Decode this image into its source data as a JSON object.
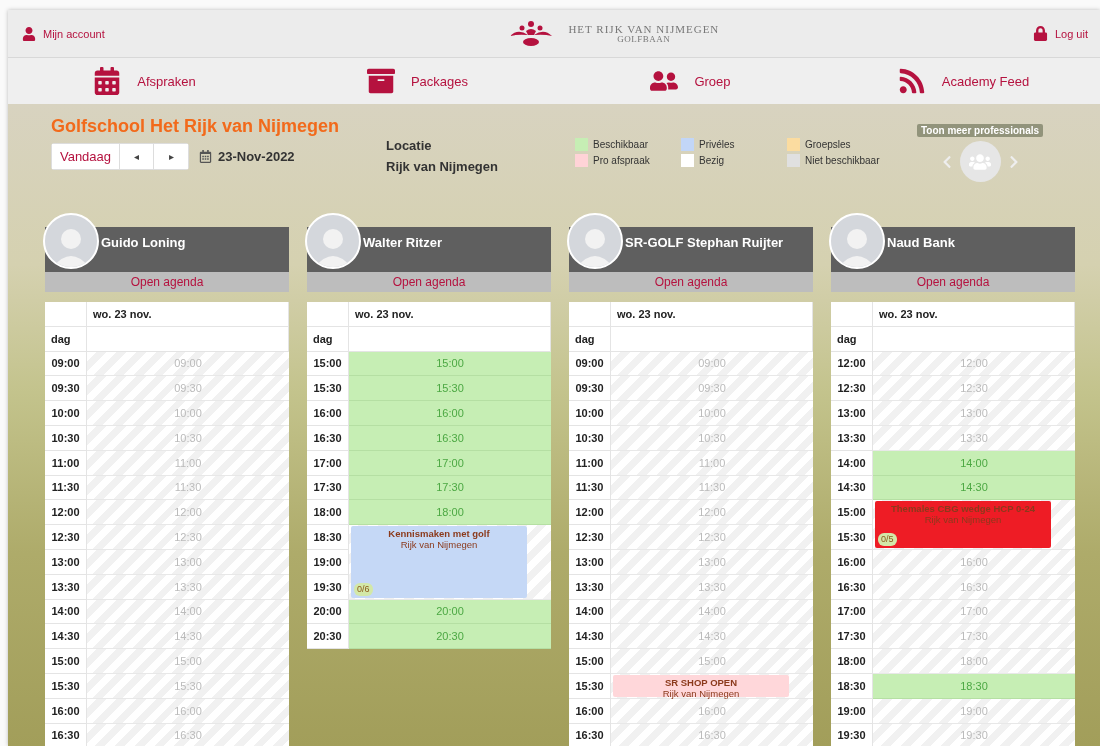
{
  "header": {
    "account": "Mijn account",
    "logo_line_1": "HET RIJK VAN NIJMEGEN",
    "logo_line_2": "GOLFBAAN",
    "logout": "Log uit"
  },
  "nav": [
    {
      "label": "Afspraken"
    },
    {
      "label": "Packages"
    },
    {
      "label": "Groep"
    },
    {
      "label": "Academy Feed"
    }
  ],
  "title": "Golfschool Het Rijk van Nijmegen",
  "controls": {
    "today": "Vandaag",
    "prev": "◂",
    "next": "▸",
    "date": "23-Nov-2022"
  },
  "location": {
    "label": "Locatie",
    "value": "Rijk van Nijmegen"
  },
  "legend": [
    {
      "label": "Beschikbaar",
      "color": "#c6eeb4"
    },
    {
      "label": "Privéles",
      "color": "#c2d6f7"
    },
    {
      "label": "Groepsles",
      "color": "#fbdca0"
    },
    {
      "label": "Pro afspraak",
      "color": "#ffd3d7"
    },
    {
      "label": "Bezig",
      "color": "#ffffff"
    },
    {
      "label": "Niet beschikbaar",
      "color": "#e0e0e0"
    }
  ],
  "more_pros": {
    "label": "Toon meer professionals"
  },
  "agendas": [
    {
      "name": "Guido Loning",
      "open": "Open agenda",
      "day": "wo. 23 nov.",
      "dag": "dag",
      "rows": [
        {
          "time": "09:00",
          "kind": "unavailable",
          "label": "09:00"
        },
        {
          "time": "09:30",
          "kind": "unavailable",
          "label": "09:30"
        },
        {
          "time": "10:00",
          "kind": "unavailable",
          "label": "10:00"
        },
        {
          "time": "10:30",
          "kind": "unavailable",
          "label": "10:30"
        },
        {
          "time": "11:00",
          "kind": "unavailable",
          "label": "11:00"
        },
        {
          "time": "11:30",
          "kind": "unavailable",
          "label": "11:30"
        },
        {
          "time": "12:00",
          "kind": "unavailable",
          "label": "12:00"
        },
        {
          "time": "12:30",
          "kind": "unavailable",
          "label": "12:30"
        },
        {
          "time": "13:00",
          "kind": "unavailable",
          "label": "13:00"
        },
        {
          "time": "13:30",
          "kind": "unavailable",
          "label": "13:30"
        },
        {
          "time": "14:00",
          "kind": "unavailable",
          "label": "14:00"
        },
        {
          "time": "14:30",
          "kind": "unavailable",
          "label": "14:30"
        },
        {
          "time": "15:00",
          "kind": "unavailable",
          "label": "15:00"
        },
        {
          "time": "15:30",
          "kind": "unavailable",
          "label": "15:30"
        },
        {
          "time": "16:00",
          "kind": "unavailable",
          "label": "16:00"
        },
        {
          "time": "16:30",
          "kind": "unavailable",
          "label": "16:30"
        }
      ]
    },
    {
      "name": "Walter Ritzer",
      "open": "Open agenda",
      "day": "wo. 23 nov.",
      "dag": "dag",
      "rows": [
        {
          "time": "15:00",
          "kind": "available",
          "label": "15:00"
        },
        {
          "time": "15:30",
          "kind": "available",
          "label": "15:30"
        },
        {
          "time": "16:00",
          "kind": "available",
          "label": "16:00"
        },
        {
          "time": "16:30",
          "kind": "available",
          "label": "16:30"
        },
        {
          "time": "17:00",
          "kind": "available",
          "label": "17:00"
        },
        {
          "time": "17:30",
          "kind": "available",
          "label": "17:30"
        },
        {
          "time": "18:00",
          "kind": "available",
          "label": "18:00"
        },
        {
          "time": "18:30",
          "kind": "event",
          "event": {
            "title": "Kennismaken met golf",
            "place": "Rijk van Nijmegen",
            "count": "0/6",
            "color": "#c5d8f6"
          }
        },
        {
          "time": "19:00",
          "kind": "continued"
        },
        {
          "time": "19:30",
          "kind": "continued"
        },
        {
          "time": "20:00",
          "kind": "available",
          "label": "20:00"
        },
        {
          "time": "20:30",
          "kind": "available",
          "label": "20:30"
        }
      ]
    },
    {
      "name": "SR-GOLF Stephan Ruijter",
      "open": "Open agenda",
      "day": "wo. 23 nov.",
      "dag": "dag",
      "rows": [
        {
          "time": "09:00",
          "kind": "unavailable",
          "label": "09:00"
        },
        {
          "time": "09:30",
          "kind": "unavailable",
          "label": "09:30"
        },
        {
          "time": "10:00",
          "kind": "unavailable",
          "label": "10:00"
        },
        {
          "time": "10:30",
          "kind": "unavailable",
          "label": "10:30"
        },
        {
          "time": "11:00",
          "kind": "unavailable",
          "label": "11:00"
        },
        {
          "time": "11:30",
          "kind": "unavailable",
          "label": "11:30"
        },
        {
          "time": "12:00",
          "kind": "unavailable",
          "label": "12:00"
        },
        {
          "time": "12:30",
          "kind": "unavailable",
          "label": "12:30"
        },
        {
          "time": "13:00",
          "kind": "unavailable",
          "label": "13:00"
        },
        {
          "time": "13:30",
          "kind": "unavailable",
          "label": "13:30"
        },
        {
          "time": "14:00",
          "kind": "unavailable",
          "label": "14:00"
        },
        {
          "time": "14:30",
          "kind": "unavailable",
          "label": "14:30"
        },
        {
          "time": "15:00",
          "kind": "unavailable",
          "label": "15:00"
        },
        {
          "time": "15:30",
          "kind": "event",
          "event": {
            "title": "SR SHOP OPEN",
            "place": "Rijk van Nijmegen",
            "color": "#ffd7da"
          }
        },
        {
          "time": "16:00",
          "kind": "unavailable",
          "label": "16:00"
        },
        {
          "time": "16:30",
          "kind": "unavailable",
          "label": "16:30"
        }
      ]
    },
    {
      "name": "Naud Bank",
      "open": "Open agenda",
      "day": "wo. 23 nov.",
      "dag": "dag",
      "rows": [
        {
          "time": "12:00",
          "kind": "unavailable",
          "label": "12:00"
        },
        {
          "time": "12:30",
          "kind": "unavailable",
          "label": "12:30"
        },
        {
          "time": "13:00",
          "kind": "unavailable",
          "label": "13:00"
        },
        {
          "time": "13:30",
          "kind": "unavailable",
          "label": "13:30"
        },
        {
          "time": "14:00",
          "kind": "available",
          "label": "14:00"
        },
        {
          "time": "14:30",
          "kind": "available",
          "label": "14:30"
        },
        {
          "time": "15:00",
          "kind": "event",
          "event": {
            "title": "Themales CBG wedge HCP 0-24",
            "place": "Rijk van Nijmegen",
            "count": "0/5",
            "color": "#ee1c25"
          }
        },
        {
          "time": "15:30",
          "kind": "continued"
        },
        {
          "time": "16:00",
          "kind": "unavailable",
          "label": "16:00"
        },
        {
          "time": "16:30",
          "kind": "unavailable",
          "label": "16:30"
        },
        {
          "time": "17:00",
          "kind": "unavailable",
          "label": "17:00"
        },
        {
          "time": "17:30",
          "kind": "unavailable",
          "label": "17:30"
        },
        {
          "time": "18:00",
          "kind": "unavailable",
          "label": "18:00"
        },
        {
          "time": "18:30",
          "kind": "available",
          "label": "18:30"
        },
        {
          "time": "19:00",
          "kind": "unavailable",
          "label": "19:00"
        },
        {
          "time": "19:30",
          "kind": "unavailable",
          "label": "19:30"
        }
      ]
    }
  ]
}
